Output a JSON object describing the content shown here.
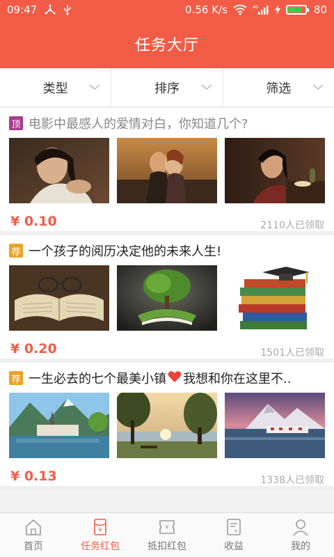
{
  "status_bar": {
    "time": "09:47",
    "network_speed": "0.56 K/s",
    "battery": "80",
    "battery_level": 0.8,
    "icons": [
      "usb-tether-icon",
      "usb-icon",
      "wifi-icon",
      "signal-4g-icon",
      "charging-icon",
      "battery-icon"
    ]
  },
  "app_bar": {
    "title": "任务大厅"
  },
  "filters": [
    {
      "label": "类型"
    },
    {
      "label": "排序"
    },
    {
      "label": "筛选"
    }
  ],
  "tasks": [
    {
      "tag": "顶",
      "tag_color": "#a93c8e",
      "title": "电影中最感人的爱情对白，你知道几个?",
      "price": "¥ 0.10",
      "claimed": "2110人已领取",
      "images": [
        "portrait-woman-photo",
        "couple-on-ship-photo",
        "woman-drinking-tea-photo"
      ]
    },
    {
      "tag": "荐",
      "tag_color": "#e8a32a",
      "title": "一个孩子的阅历决定他的未来人生!",
      "price": "¥ 0.20",
      "claimed": "1501人已领取",
      "images": [
        "open-book-glasses-photo",
        "tree-on-book-photo",
        "book-stack-cap-photo"
      ]
    },
    {
      "tag": "荐",
      "tag_color": "#e8a32a",
      "title_before": "一生必去的七个最美小镇",
      "title_after": "我想和你在这里不..",
      "price": "¥ 0.13",
      "claimed": "1338人已领取",
      "images": [
        "lakeside-village-photo",
        "lake-tree-sunrise-photo",
        "snowy-coast-village-photo"
      ]
    }
  ],
  "bottom_nav": [
    {
      "label": "首页",
      "icon": "home-icon",
      "active": false
    },
    {
      "label": "任务红包",
      "icon": "red-packet-icon",
      "active": true
    },
    {
      "label": "抵扣红包",
      "icon": "coupon-icon",
      "active": false
    },
    {
      "label": "收益",
      "icon": "earnings-icon",
      "active": false
    },
    {
      "label": "我的",
      "icon": "user-icon",
      "active": false
    }
  ],
  "colors": {
    "accent": "#f25c47",
    "tag_top": "#a93c8e",
    "tag_rec": "#e8a32a"
  }
}
